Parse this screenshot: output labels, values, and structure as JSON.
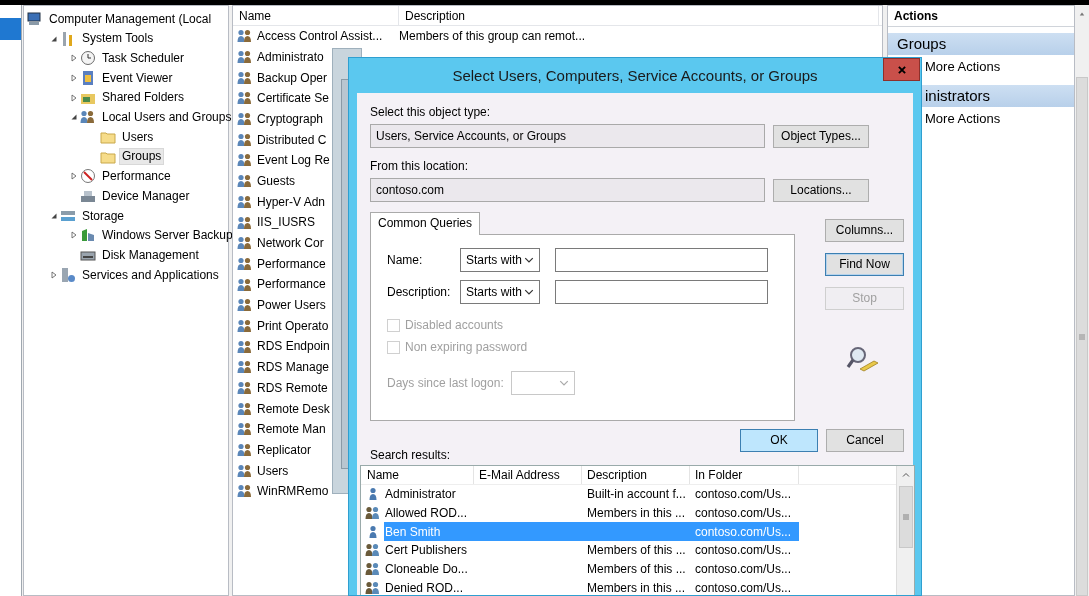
{
  "tree": [
    {
      "label": "Computer Management (Local",
      "selected": false,
      "children": [
        {
          "label": "System Tools",
          "expanded": true,
          "selected": false,
          "children": [
            {
              "label": "Task Scheduler",
              "expanded": false,
              "selected": false
            },
            {
              "label": "Event Viewer",
              "expanded": false,
              "selected": false
            },
            {
              "label": "Shared Folders",
              "expanded": false,
              "selected": false
            },
            {
              "label": "Local Users and Groups",
              "expanded": true,
              "selected": false,
              "children": [
                {
                  "label": "Users",
                  "selected": false
                },
                {
                  "label": "Groups",
                  "selected": true
                }
              ]
            },
            {
              "label": "Performance",
              "expanded": false,
              "selected": false
            },
            {
              "label": "Device Manager",
              "selected": false
            }
          ]
        },
        {
          "label": "Storage",
          "expanded": true,
          "selected": false,
          "children": [
            {
              "label": "Windows Server Backup",
              "expanded": false,
              "selected": false
            },
            {
              "label": "Disk Management",
              "selected": false
            }
          ]
        },
        {
          "label": "Services and Applications",
          "expanded": false,
          "selected": false
        }
      ]
    }
  ],
  "group_list": {
    "columns": [
      "Name",
      "Description"
    ],
    "rows": [
      {
        "name": "Access Control Assist...",
        "description": "Members of this group can remot..."
      },
      {
        "name": "Administrato"
      },
      {
        "name": "Backup Oper"
      },
      {
        "name": "Certificate Se"
      },
      {
        "name": "Cryptograph"
      },
      {
        "name": "Distributed C"
      },
      {
        "name": "Event Log Re"
      },
      {
        "name": "Guests"
      },
      {
        "name": "Hyper-V Adn"
      },
      {
        "name": "IIS_IUSRS"
      },
      {
        "name": "Network Cor"
      },
      {
        "name": "Performance"
      },
      {
        "name": "Performance"
      },
      {
        "name": "Power Users"
      },
      {
        "name": "Print Operato"
      },
      {
        "name": "RDS Endpoin"
      },
      {
        "name": "RDS Manage"
      },
      {
        "name": "RDS Remote"
      },
      {
        "name": "Remote Desk"
      },
      {
        "name": "Remote Man"
      },
      {
        "name": "Replicator"
      },
      {
        "name": "Users"
      },
      {
        "name": "WinRMRemo"
      }
    ]
  },
  "actions": {
    "title": "Actions",
    "sections": [
      {
        "title": "Groups",
        "items": [
          "More Actions"
        ]
      },
      {
        "title": "inistrators",
        "items": [
          "More Actions"
        ]
      }
    ]
  },
  "dialog": {
    "title": "Select Users, Computers, Service Accounts, or Groups",
    "object_type": {
      "label": "Select this object type:",
      "value": "Users, Service Accounts, or Groups",
      "button": "Object Types..."
    },
    "location": {
      "label": "From this location:",
      "value": "contoso.com",
      "button": "Locations..."
    },
    "query_tab": {
      "label": "Common Queries",
      "selected": true
    },
    "queries": [
      {
        "label": "Name:",
        "operator": "Starts with"
      },
      {
        "label": "Description:",
        "operator": "Starts with"
      }
    ],
    "checkboxes": [
      {
        "label": "Disabled accounts",
        "checked": false,
        "disabled": true
      },
      {
        "label": "Non expiring password",
        "checked": false,
        "disabled": true
      }
    ],
    "days": {
      "label": "Days since last logon:",
      "disabled": true
    },
    "side_buttons": [
      {
        "label": "Columns...",
        "disabled": false,
        "focused": false
      },
      {
        "label": "Find Now",
        "disabled": false,
        "focused": true
      },
      {
        "label": "Stop",
        "disabled": true,
        "focused": false
      }
    ],
    "results_label": "Search results:",
    "buttons": [
      {
        "label": "OK",
        "default": true
      },
      {
        "label": "Cancel",
        "default": false
      }
    ],
    "results": {
      "columns": [
        "Name",
        "E-Mail Address",
        "Description",
        "In Folder"
      ],
      "rows": [
        {
          "kind": "user",
          "name": "Administrator",
          "description": "Built-in account f...",
          "folder": "contoso.com/Us...",
          "selected": false
        },
        {
          "kind": "group",
          "name": "Allowed ROD...",
          "description": "Members in this ...",
          "folder": "contoso.com/Us...",
          "selected": false
        },
        {
          "kind": "user",
          "name": "Ben Smith",
          "folder": "contoso.com/Us...",
          "selected": true
        },
        {
          "kind": "group",
          "name": "Cert Publishers",
          "description": "Members of this ...",
          "folder": "contoso.com/Us...",
          "selected": false
        },
        {
          "kind": "group",
          "name": "Cloneable Do...",
          "description": "Members of this ...",
          "folder": "contoso.com/Us...",
          "selected": false
        },
        {
          "kind": "group",
          "name": "Denied ROD...",
          "description": "Members in this ...",
          "folder": "contoso.com/Us...",
          "selected": false
        }
      ]
    }
  }
}
